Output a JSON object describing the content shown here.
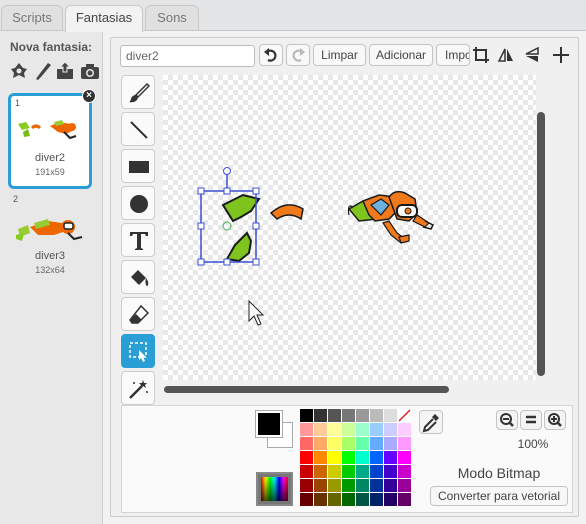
{
  "tabs": [
    {
      "label": "Scripts",
      "active": false
    },
    {
      "label": "Fantasias",
      "active": true
    },
    {
      "label": "Sons",
      "active": false
    }
  ],
  "costume_panel": {
    "title": "Nova fantasia:",
    "actions": [
      "sprite-library-icon",
      "paint-brush-icon",
      "upload-icon",
      "camera-icon"
    ],
    "costumes": [
      {
        "number": "1",
        "name": "diver2",
        "size": "191x59",
        "selected": true
      },
      {
        "number": "2",
        "name": "diver3",
        "size": "132x64",
        "selected": false
      }
    ]
  },
  "toolbar": {
    "costume_name": "diver2",
    "clear_label": "Limpar",
    "add_label": "Adicionar",
    "import_label": "Importar"
  },
  "tools": [
    "brush-tool",
    "line-tool",
    "rectangle-tool",
    "ellipse-tool",
    "text-tool",
    "fill-tool",
    "eraser-tool",
    "select-tool",
    "stamp-tool"
  ],
  "active_tool": "select-tool",
  "colors": {
    "accent": "#2a9fd6",
    "foreground": "#000000",
    "background": "#ffffff"
  },
  "palette": [
    [
      "#000000",
      "#333333",
      "#555555",
      "#777777",
      "#999999",
      "#bbbbbb",
      "#dddddd",
      "#ffffff"
    ],
    [
      "#ff9999",
      "#ffcc99",
      "#ffff99",
      "#ccff99",
      "#99ffcc",
      "#99ccff",
      "#ccccff",
      "#ffccff"
    ],
    [
      "#ff6666",
      "#ffaa66",
      "#ffff66",
      "#aaff66",
      "#66ffaa",
      "#66aaff",
      "#aaaaff",
      "#ff99ff"
    ],
    [
      "#ff0000",
      "#ff8800",
      "#ffff00",
      "#00ff00",
      "#00ffcc",
      "#0066ff",
      "#6600ff",
      "#ff00ff"
    ],
    [
      "#cc0000",
      "#cc6600",
      "#cccc00",
      "#00cc00",
      "#00aa88",
      "#0044cc",
      "#4400cc",
      "#cc00cc"
    ],
    [
      "#990000",
      "#994400",
      "#999900",
      "#009900",
      "#008866",
      "#003399",
      "#330099",
      "#990099"
    ],
    [
      "#660000",
      "#663300",
      "#666600",
      "#006600",
      "#005544",
      "#002266",
      "#220066",
      "#660066"
    ]
  ],
  "zoom": {
    "level": "100%"
  },
  "mode_label": "Modo Bitmap",
  "convert_label": "Converter para vetorial"
}
